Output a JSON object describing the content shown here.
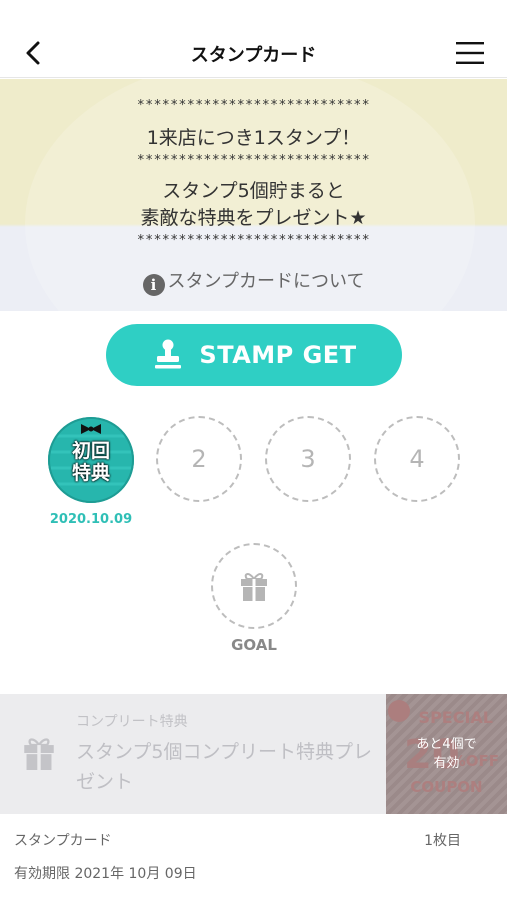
{
  "header": {
    "title": "スタンプカード",
    "back_icon": "chevron-left-icon",
    "menu_icon": "hamburger-menu-icon"
  },
  "banner": {
    "stars": "****************************",
    "line1": "1来店につき1スタンプ！",
    "line2": "スタンプ5個貯まると",
    "line3": "素敵な特典をプレゼント★",
    "about_link": "スタンプカードについて",
    "info_icon": "i"
  },
  "stamp_button": {
    "label": "STAMP GET",
    "icon": "stamp-icon",
    "color": "#2fcfc4"
  },
  "stamps": {
    "first": {
      "label_top": "初回",
      "label_bottom": "特典",
      "date": "2020.10.09"
    },
    "slots": [
      "2",
      "3",
      "4"
    ],
    "goal_label": "GOAL",
    "goal_icon": "gift-icon"
  },
  "reward": {
    "small_label": "コンプリート特典",
    "title": "スタンプ5個コンプリート特典プレゼント",
    "coupon": {
      "special": "SPECIAL",
      "big": "20",
      "off": "%OFF",
      "word": "COUPON",
      "remain_line1": "あと4個で",
      "remain_line2": "有効"
    }
  },
  "footer": {
    "card_label": "スタンプカード",
    "card_count": "1枚目",
    "expiry": "有効期限 2021年 10月 09日"
  },
  "colors": {
    "accent": "#2fcfc4",
    "banner_top": "#efeccb",
    "banner_bottom": "#eceef5"
  }
}
